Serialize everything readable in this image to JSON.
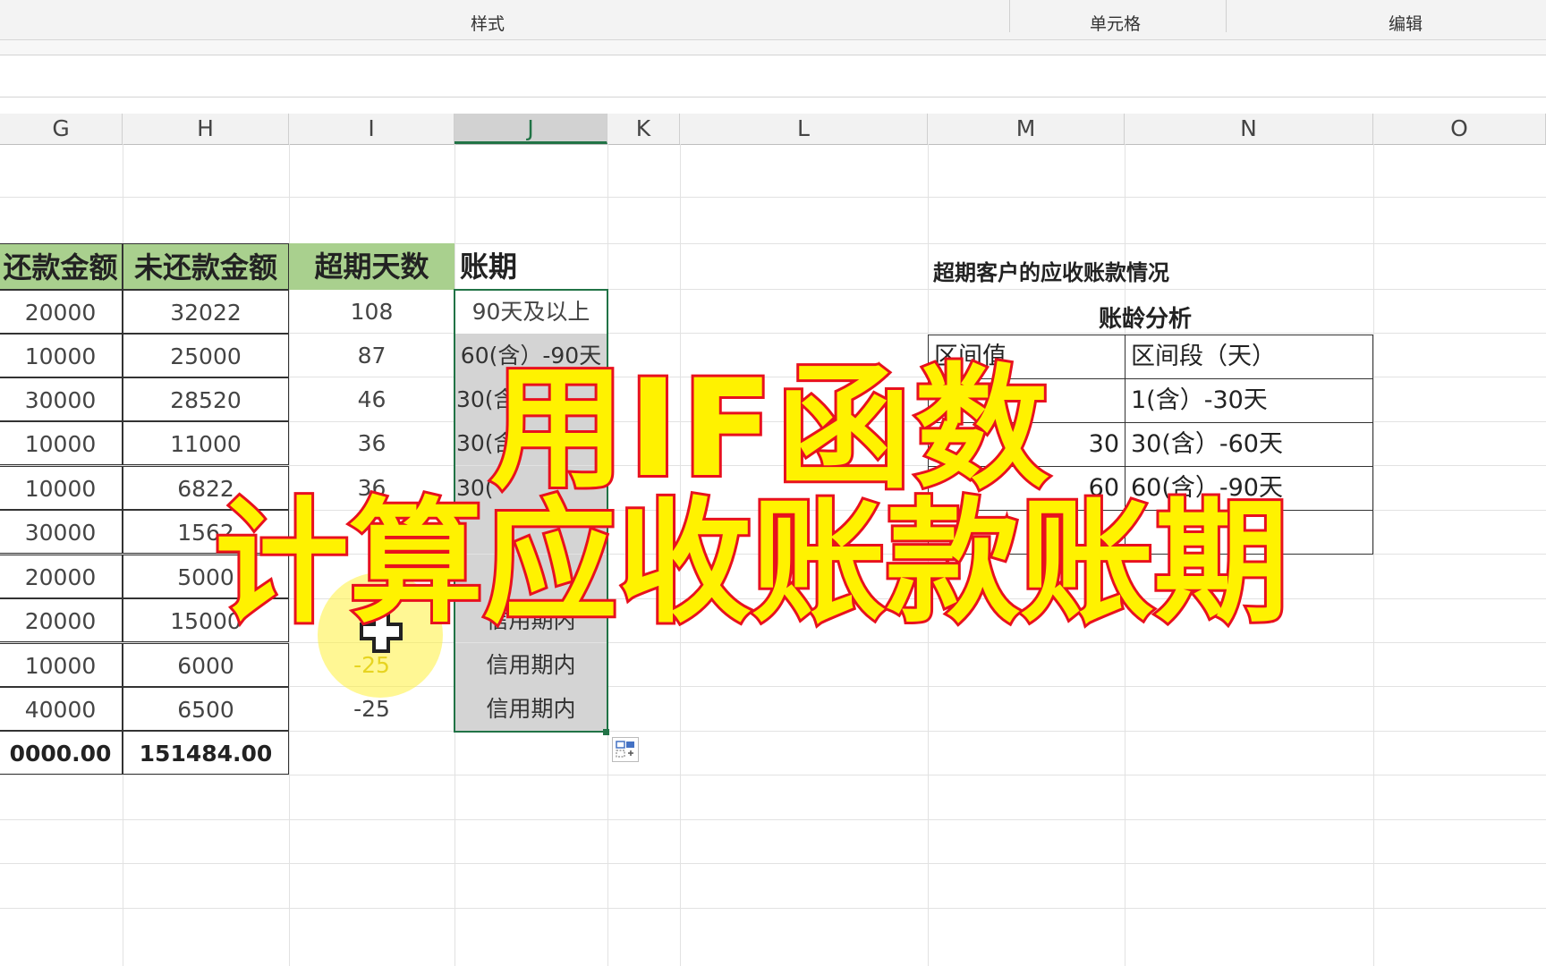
{
  "ribbon": {
    "group_styles": "样式",
    "group_cells": "单元格",
    "group_edit": "编辑"
  },
  "columns": [
    "G",
    "H",
    "I",
    "J",
    "K",
    "L",
    "M",
    "N",
    "O"
  ],
  "table": {
    "headers": [
      "还款金额",
      "未还款金额",
      "超期天数",
      "账期"
    ],
    "rows": [
      {
        "paid": "20000",
        "unpaid": "32022",
        "overdue": "108",
        "term": "90天及以上"
      },
      {
        "paid": "10000",
        "unpaid": "25000",
        "overdue": "87",
        "term": "60(含）-90天"
      },
      {
        "paid": "30000",
        "unpaid": "28520",
        "overdue": "46",
        "term": "30(含"
      },
      {
        "paid": "10000",
        "unpaid": "11000",
        "overdue": "36",
        "term": "30(含"
      },
      {
        "paid": "10000",
        "unpaid": "6822",
        "overdue": "36",
        "term": "30("
      },
      {
        "paid": "30000",
        "unpaid": "1562",
        "overdue": "",
        "term": ""
      },
      {
        "paid": "20000",
        "unpaid": "5000",
        "overdue": "",
        "term": ""
      },
      {
        "paid": "20000",
        "unpaid": "15000",
        "overdue": "",
        "term": "信用期内"
      },
      {
        "paid": "10000",
        "unpaid": "6000",
        "overdue": "-25",
        "term": "信用期内"
      },
      {
        "paid": "40000",
        "unpaid": "6500",
        "overdue": "-25",
        "term": "信用期内"
      }
    ],
    "total_paid": "0000.00",
    "total_unpaid": "151484.00"
  },
  "right_table": {
    "title": "超期客户的应收账款情况",
    "subtitle": "账龄分析",
    "col1": "区间值",
    "col2": "区间段（天）",
    "rows": [
      {
        "value": "",
        "range": "1(含）-30天"
      },
      {
        "value": "30",
        "range": "30(含）-60天"
      },
      {
        "value": "60",
        "range": "60(含）-90天"
      }
    ]
  },
  "overlay": {
    "line1": "用IF函数",
    "line2": "计算应收账款账期"
  },
  "colors": {
    "header_green": "#a9d08e",
    "accent_green": "#217346",
    "overlay_fill": "#fff200",
    "overlay_stroke": "#e8111e"
  }
}
